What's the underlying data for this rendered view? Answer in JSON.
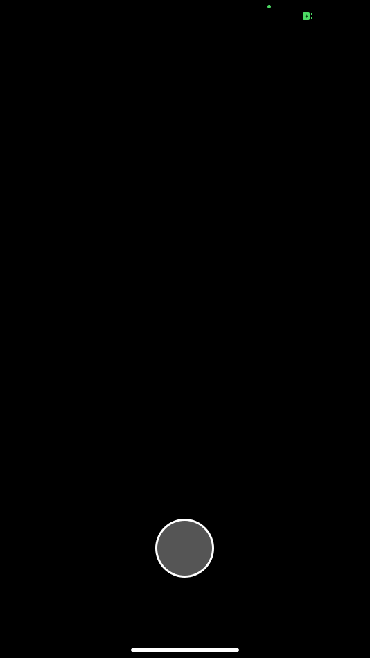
{
  "status_bar": {
    "camera_indicator_icon": "camera-in-use-dot",
    "battery_icon": "battery-charging-icon",
    "indicator_color": "#4cd964"
  },
  "viewfinder": {
    "background_color": "#000000"
  },
  "controls": {
    "shutter_icon": "shutter-button",
    "shutter_fill_color": "#555555",
    "shutter_ring_color": "#ffffff"
  },
  "home_indicator": {
    "color": "#ffffff"
  }
}
